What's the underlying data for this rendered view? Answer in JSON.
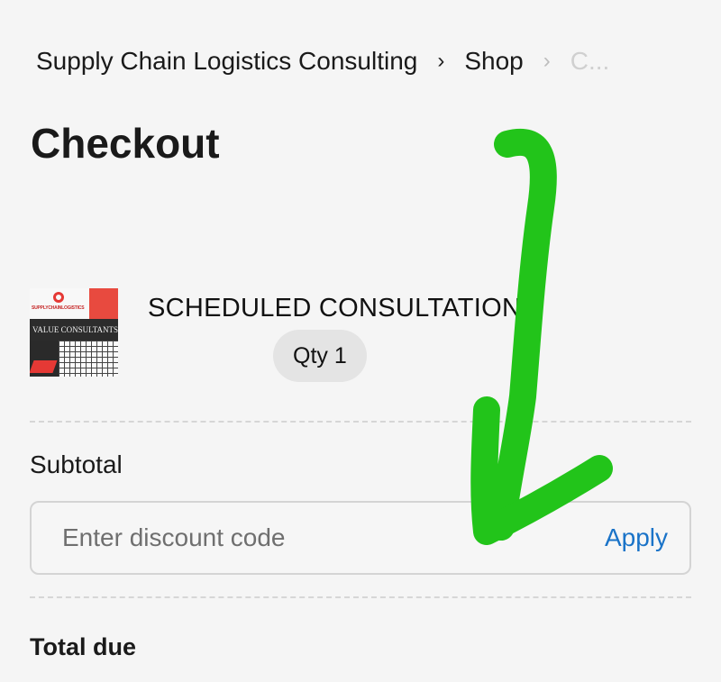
{
  "breadcrumb": {
    "items": [
      "Supply Chain Logistics Consulting",
      "Shop",
      "C..."
    ]
  },
  "page": {
    "title": "Checkout"
  },
  "product": {
    "thumb_logo_text": "SUPPLYCHAINLOGISTICS",
    "thumb_caption": "VALUE CONSULTANTS",
    "name": "SCHEDULED CONSULTATION:",
    "quantity_label": "Qty 1"
  },
  "summary": {
    "subtotal_label": "Subtotal",
    "discount_placeholder": "Enter discount code",
    "apply_label": "Apply",
    "total_label": "Total due"
  },
  "annotation": {
    "arrow_color": "#22c41a"
  },
  "colors": {
    "background": "#f5f5f5",
    "link": "#1a73c8",
    "accent_red": "#e53935"
  }
}
